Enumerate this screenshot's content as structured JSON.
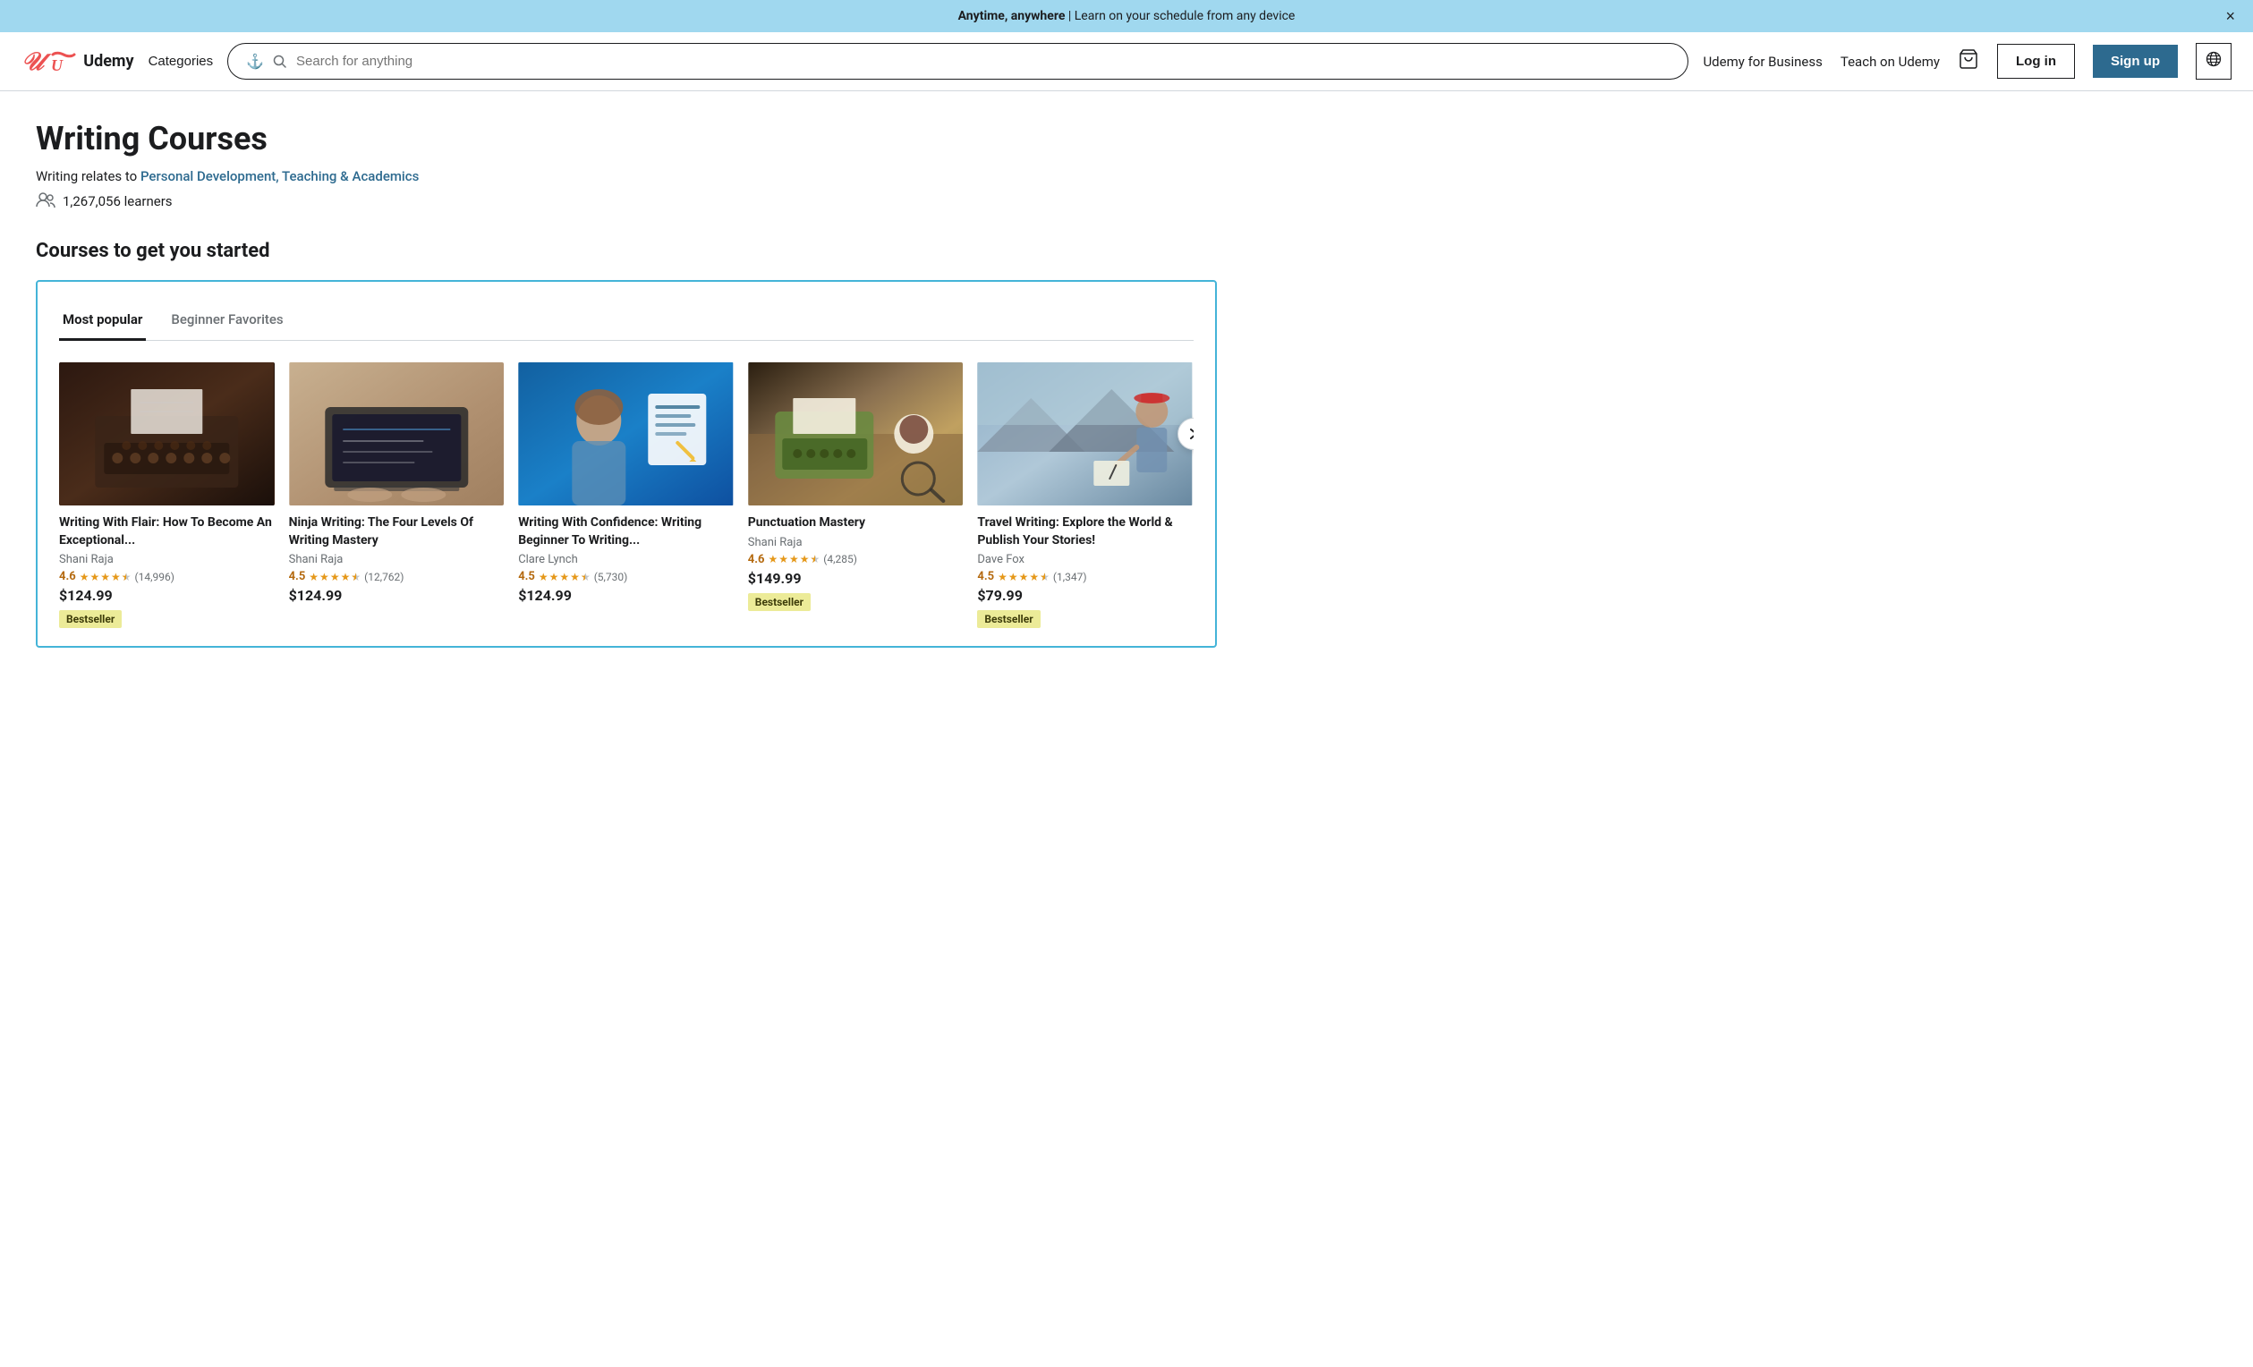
{
  "banner": {
    "text_bold": "Anytime, anywhere",
    "text_normal": " | Learn on your schedule from any device",
    "close_label": "×"
  },
  "header": {
    "logo_text": "Udemy",
    "categories_label": "Categories",
    "search_placeholder": "Search for anything",
    "nav_business": "Udemy for Business",
    "nav_teach": "Teach on Udemy",
    "login_label": "Log in",
    "signup_label": "Sign up"
  },
  "page": {
    "title": "Writing Courses",
    "subtitle_prefix": "Writing relates to ",
    "subtitle_links": "Personal Development, Teaching & Academics",
    "learners_count": "1,267,056 learners",
    "section_title": "Courses to get you started"
  },
  "tabs": [
    {
      "label": "Most popular",
      "active": true
    },
    {
      "label": "Beginner Favorites",
      "active": false
    }
  ],
  "courses": [
    {
      "id": 1,
      "title": "Writing With Flair: How To Become An Exceptional...",
      "author": "Shani Raja",
      "rating": "4.6",
      "reviews": "(14,996)",
      "price": "$124.99",
      "bestseller": true,
      "thumb_type": "typewriter-old",
      "stars": [
        1,
        1,
        1,
        1,
        0.5
      ]
    },
    {
      "id": 2,
      "title": "Ninja Writing: The Four Levels Of Writing Mastery",
      "author": "Shani Raja",
      "rating": "4.5",
      "reviews": "(12,762)",
      "price": "$124.99",
      "bestseller": false,
      "thumb_type": "laptop",
      "stars": [
        1,
        1,
        1,
        1,
        0.5
      ]
    },
    {
      "id": 3,
      "title": "Writing With Confidence: Writing Beginner To Writing...",
      "author": "Clare Lynch",
      "rating": "4.5",
      "reviews": "(5,730)",
      "price": "$124.99",
      "bestseller": false,
      "thumb_type": "confidence",
      "stars": [
        1,
        1,
        1,
        1,
        0.5
      ]
    },
    {
      "id": 4,
      "title": "Punctuation Mastery",
      "author": "Shani Raja",
      "rating": "4.6",
      "reviews": "(4,285)",
      "price": "$149.99",
      "bestseller": true,
      "thumb_type": "punctuation",
      "stars": [
        1,
        1,
        1,
        1,
        0.5
      ]
    },
    {
      "id": 5,
      "title": "Travel Writing: Explore the World & Publish Your Stories!",
      "author": "Dave Fox",
      "rating": "4.5",
      "reviews": "(1,347)",
      "price": "$79.99",
      "bestseller": true,
      "thumb_type": "travel",
      "stars": [
        1,
        1,
        1,
        1,
        0.5
      ]
    }
  ],
  "colors": {
    "accent_blue": "#2d6a8f",
    "banner_bg": "#a0d8ef",
    "star_color": "#e59819",
    "star_rating": "#b4690e",
    "bestseller_bg": "#eceb98",
    "border_highlight": "#44b4d8"
  }
}
